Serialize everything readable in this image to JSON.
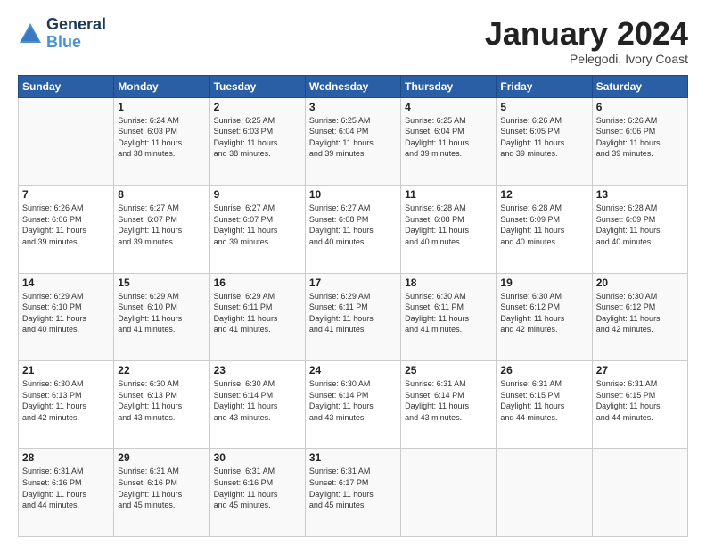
{
  "logo": {
    "line1": "General",
    "line2": "Blue"
  },
  "title": "January 2024",
  "subtitle": "Pelegodi, Ivory Coast",
  "days_of_week": [
    "Sunday",
    "Monday",
    "Tuesday",
    "Wednesday",
    "Thursday",
    "Friday",
    "Saturday"
  ],
  "weeks": [
    [
      {
        "day": "",
        "info": ""
      },
      {
        "day": "1",
        "info": "Sunrise: 6:24 AM\nSunset: 6:03 PM\nDaylight: 11 hours\nand 38 minutes."
      },
      {
        "day": "2",
        "info": "Sunrise: 6:25 AM\nSunset: 6:03 PM\nDaylight: 11 hours\nand 38 minutes."
      },
      {
        "day": "3",
        "info": "Sunrise: 6:25 AM\nSunset: 6:04 PM\nDaylight: 11 hours\nand 39 minutes."
      },
      {
        "day": "4",
        "info": "Sunrise: 6:25 AM\nSunset: 6:04 PM\nDaylight: 11 hours\nand 39 minutes."
      },
      {
        "day": "5",
        "info": "Sunrise: 6:26 AM\nSunset: 6:05 PM\nDaylight: 11 hours\nand 39 minutes."
      },
      {
        "day": "6",
        "info": "Sunrise: 6:26 AM\nSunset: 6:06 PM\nDaylight: 11 hours\nand 39 minutes."
      }
    ],
    [
      {
        "day": "7",
        "info": ""
      },
      {
        "day": "8",
        "info": "Sunrise: 6:27 AM\nSunset: 6:07 PM\nDaylight: 11 hours\nand 39 minutes."
      },
      {
        "day": "9",
        "info": "Sunrise: 6:27 AM\nSunset: 6:07 PM\nDaylight: 11 hours\nand 39 minutes."
      },
      {
        "day": "10",
        "info": "Sunrise: 6:27 AM\nSunset: 6:08 PM\nDaylight: 11 hours\nand 40 minutes."
      },
      {
        "day": "11",
        "info": "Sunrise: 6:28 AM\nSunset: 6:08 PM\nDaylight: 11 hours\nand 40 minutes."
      },
      {
        "day": "12",
        "info": "Sunrise: 6:28 AM\nSunset: 6:09 PM\nDaylight: 11 hours\nand 40 minutes."
      },
      {
        "day": "13",
        "info": "Sunrise: 6:28 AM\nSunset: 6:09 PM\nDaylight: 11 hours\nand 40 minutes."
      }
    ],
    [
      {
        "day": "14",
        "info": ""
      },
      {
        "day": "15",
        "info": "Sunrise: 6:29 AM\nSunset: 6:10 PM\nDaylight: 11 hours\nand 41 minutes."
      },
      {
        "day": "16",
        "info": "Sunrise: 6:29 AM\nSunset: 6:11 PM\nDaylight: 11 hours\nand 41 minutes."
      },
      {
        "day": "17",
        "info": "Sunrise: 6:29 AM\nSunset: 6:11 PM\nDaylight: 11 hours\nand 41 minutes."
      },
      {
        "day": "18",
        "info": "Sunrise: 6:30 AM\nSunset: 6:11 PM\nDaylight: 11 hours\nand 41 minutes."
      },
      {
        "day": "19",
        "info": "Sunrise: 6:30 AM\nSunset: 6:12 PM\nDaylight: 11 hours\nand 42 minutes."
      },
      {
        "day": "20",
        "info": "Sunrise: 6:30 AM\nSunset: 6:12 PM\nDaylight: 11 hours\nand 42 minutes."
      }
    ],
    [
      {
        "day": "21",
        "info": ""
      },
      {
        "day": "22",
        "info": "Sunrise: 6:30 AM\nSunset: 6:13 PM\nDaylight: 11 hours\nand 43 minutes."
      },
      {
        "day": "23",
        "info": "Sunrise: 6:30 AM\nSunset: 6:14 PM\nDaylight: 11 hours\nand 43 minutes."
      },
      {
        "day": "24",
        "info": "Sunrise: 6:30 AM\nSunset: 6:14 PM\nDaylight: 11 hours\nand 43 minutes."
      },
      {
        "day": "25",
        "info": "Sunrise: 6:31 AM\nSunset: 6:14 PM\nDaylight: 11 hours\nand 43 minutes."
      },
      {
        "day": "26",
        "info": "Sunrise: 6:31 AM\nSunset: 6:15 PM\nDaylight: 11 hours\nand 44 minutes."
      },
      {
        "day": "27",
        "info": "Sunrise: 6:31 AM\nSunset: 6:15 PM\nDaylight: 11 hours\nand 44 minutes."
      }
    ],
    [
      {
        "day": "28",
        "info": "Sunrise: 6:31 AM\nSunset: 6:16 PM\nDaylight: 11 hours\nand 44 minutes."
      },
      {
        "day": "29",
        "info": "Sunrise: 6:31 AM\nSunset: 6:16 PM\nDaylight: 11 hours\nand 45 minutes."
      },
      {
        "day": "30",
        "info": "Sunrise: 6:31 AM\nSunset: 6:16 PM\nDaylight: 11 hours\nand 45 minutes."
      },
      {
        "day": "31",
        "info": "Sunrise: 6:31 AM\nSunset: 6:17 PM\nDaylight: 11 hours\nand 45 minutes."
      },
      {
        "day": "",
        "info": ""
      },
      {
        "day": "",
        "info": ""
      },
      {
        "day": "",
        "info": ""
      }
    ]
  ],
  "week7_sunday": {
    "day": "7",
    "info": "Sunrise: 6:26 AM\nSunset: 6:06 PM\nDaylight: 11 hours\nand 39 minutes."
  },
  "week3_sunday": {
    "day": "14",
    "info": "Sunrise: 6:29 AM\nSunset: 6:10 PM\nDaylight: 11 hours\nand 40 minutes."
  },
  "week4_sunday": {
    "day": "21",
    "info": "Sunrise: 6:30 AM\nSunset: 6:13 PM\nDaylight: 11 hours\nand 42 minutes."
  }
}
